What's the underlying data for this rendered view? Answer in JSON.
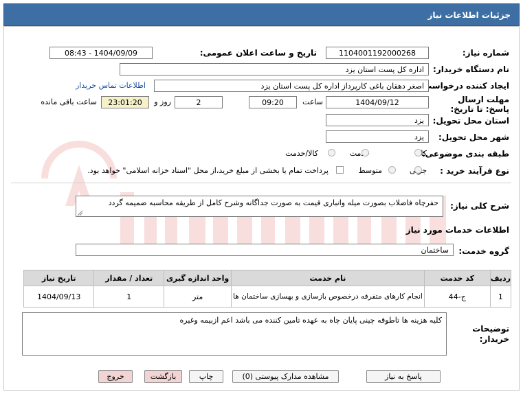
{
  "header": {
    "title": "جزئیات اطلاعات نیاز"
  },
  "form": {
    "need_number_label": "شماره نیاز:",
    "need_number": "1104001192000268",
    "announce_label": "تاریخ و ساعت اعلان عمومی:",
    "announce_value": "1404/09/09 - 08:43",
    "buyer_label": "نام دستگاه خریدار:",
    "buyer_value": "اداره کل پست استان یزد",
    "creator_label": "ایجاد کننده درخواست:",
    "creator_value": "اصغر دهقان باغی کارپرداز اداره کل پست استان یزد",
    "contact_link": "اطلاعات تماس خریدار",
    "deadline_label": "مهلت ارسال پاسخ: تا تاریخ:",
    "deadline_date": "1404/09/12",
    "time_label": "ساعت",
    "deadline_time": "09:20",
    "days_value": "2",
    "days_label": "روز و",
    "remaining_time": "23:01:20",
    "remaining_label": "ساعت باقی مانده",
    "province_label": "استان محل تحویل:",
    "province_value": "یزد",
    "city_label": "شهر محل تحویل:",
    "city_value": "یزد",
    "category_label": "طبقه بندی موضوعی:",
    "category_options": [
      "کالا",
      "خدمت",
      "کالا/خدمت"
    ],
    "process_label": "نوع فرآیند خرید :",
    "process_options": [
      "جزیی",
      "متوسط"
    ],
    "payment_note": "پرداخت تمام یا بخشی از مبلغ خرید،از محل \"اسناد خزانه اسلامی\" خواهد بود."
  },
  "summary": {
    "label": "شرح کلی نیاز:",
    "value": "حفرچاه فاضلاب  بصورت میله وانباری قیمت به صورت جداگانه وشرح کامل از طریقه محاسبه ضمیمه گردد"
  },
  "services_title": "اطلاعات خدمات مورد نیاز",
  "service_group": {
    "label": "گروه خدمت:",
    "value": "ساختمان"
  },
  "table": {
    "headers": [
      "ردیف",
      "کد خدمت",
      "نام خدمت",
      "واحد اندازه گیری",
      "تعداد / مقدار",
      "تاریخ نیاز"
    ],
    "rows": [
      [
        "1",
        "ج-44",
        "انجام کارهای متفرقه درخصوص بازسازی و بهسازی ساختمان ها",
        "متر",
        "1",
        "1404/09/13"
      ]
    ]
  },
  "buyer_notes": {
    "label": "توضیحات خریدار:",
    "value": "کلیه هزینه ها تاطوقه چینی پایان  چاه به عهده تامین کننده می باشد اعم ازبیمه وغیره"
  },
  "buttons": {
    "reply": "پاسخ به نیاز",
    "attachments": "مشاهده مدارک پیوستی (0)",
    "print": "چاپ",
    "back": "بازگشت",
    "exit": "خروج"
  },
  "colors": {
    "header_bg": "#3d6fa5",
    "link": "#1c4fa8",
    "watermark": "#e03a3a",
    "remaining_bg": "#f5f1c8"
  }
}
